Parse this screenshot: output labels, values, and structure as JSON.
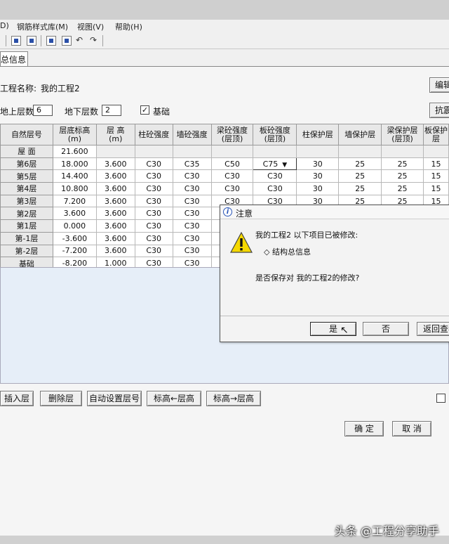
{
  "menu": {
    "items": [
      "D)",
      "钢筋样式库(M)",
      "视图(V)",
      "帮助(H)"
    ]
  },
  "tabs": [
    "总信息"
  ],
  "project": {
    "name_label": "工程名称:",
    "name_value": "我的工程2",
    "edit_button": "编辑"
  },
  "floors": {
    "above_label": "地上层数",
    "above_value": "6",
    "below_label": "地下层数",
    "below_value": "2",
    "foundation_label": "基础",
    "foundation_checked": "✓",
    "seismic_button": "抗震"
  },
  "table": {
    "headers": [
      "自然层号",
      "层底标高\n(m)",
      "层 高\n(m)",
      "柱砼强度",
      "墙砼强度",
      "梁砼强度\n(层顶)",
      "板砼强度\n(层顶)",
      "柱保护层",
      "墙保护层",
      "梁保护层\n(层顶)",
      "板保护层"
    ],
    "rows": [
      [
        "屋 面",
        "21.600",
        "",
        "",
        "",
        "",
        "",
        "",
        "",
        "",
        ""
      ],
      [
        "第6层",
        "18.000",
        "3.600",
        "C30",
        "C35",
        "C50",
        "C75",
        "30",
        "25",
        "25",
        "15"
      ],
      [
        "第5层",
        "14.400",
        "3.600",
        "C30",
        "C30",
        "C30",
        "C30",
        "30",
        "25",
        "25",
        "15"
      ],
      [
        "第4层",
        "10.800",
        "3.600",
        "C30",
        "C30",
        "C30",
        "C30",
        "30",
        "25",
        "25",
        "15"
      ],
      [
        "第3层",
        "7.200",
        "3.600",
        "C30",
        "C30",
        "C30",
        "C30",
        "30",
        "25",
        "25",
        "15"
      ],
      [
        "第2层",
        "3.600",
        "3.600",
        "C30",
        "C30",
        "",
        "",
        "",
        "",
        "",
        ""
      ],
      [
        "第1层",
        "0.000",
        "3.600",
        "C30",
        "C30",
        "",
        "",
        "",
        "",
        "",
        ""
      ],
      [
        "第-1层",
        "-3.600",
        "3.600",
        "C30",
        "C30",
        "",
        "",
        "",
        "",
        "",
        ""
      ],
      [
        "第-2层",
        "-7.200",
        "3.600",
        "C30",
        "C30",
        "",
        "",
        "",
        "",
        "",
        ""
      ],
      [
        "基础",
        "-8.200",
        "1.000",
        "C30",
        "C30",
        "",
        "",
        "",
        "",
        "",
        ""
      ]
    ]
  },
  "buttons": {
    "insert": "插入层",
    "delete": "删除层",
    "auto_number": "自动设置层号",
    "elev_to_height": "标高←层高",
    "height_to_elev": "标高→层高",
    "ok": "确 定",
    "cancel": "取 消"
  },
  "dialog": {
    "title": "注意",
    "message": "我的工程2 以下项目已被修改:",
    "item": "◇ 结构总信息",
    "question": "是否保存对 我的工程2的修改?",
    "yes": "是",
    "no": "否",
    "back": "返回查看"
  },
  "watermark": "头条 @工程分享助手",
  "colors": {
    "dialog_icon": "#2b57b8",
    "warning": "#f5d800",
    "blue_area": "#e6eef8"
  }
}
